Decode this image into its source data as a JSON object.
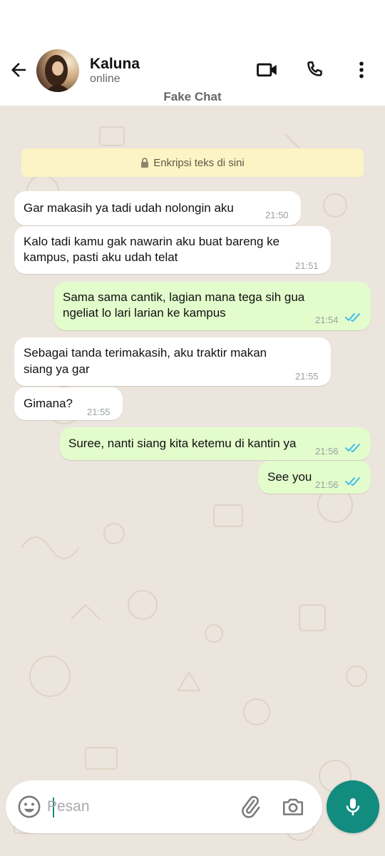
{
  "header": {
    "contact_name": "Kaluna",
    "contact_status": "online",
    "app_label": "Fake Chat",
    "icons": [
      "back-arrow-icon",
      "video-call-icon",
      "phone-icon",
      "more-vert-icon"
    ]
  },
  "encryption_notice": "Enkripsi teks di sini",
  "messages": [
    {
      "direction": "in",
      "text": "Gar makasih ya tadi udah nolongin aku",
      "time": "21:50"
    },
    {
      "direction": "in",
      "line1": "Kalo tadi kamu gak nawarin aku buat bareng ke",
      "line2": "kampus, pasti aku udah telat",
      "time": "21:51"
    },
    {
      "direction": "out",
      "line1": "Sama sama cantik, lagian mana tega sih gua",
      "line2": "ngeliat lo lari larian ke kampus",
      "time": "21:54",
      "status": "read"
    },
    {
      "direction": "in",
      "line1": "Sebagai tanda terimakasih, aku traktir makan",
      "line2": "siang ya gar",
      "time": "21:55"
    },
    {
      "direction": "in",
      "text": "Gimana?",
      "time": "21:55"
    },
    {
      "direction": "out",
      "text": "Suree, nanti siang kita ketemu di kantin ya",
      "time": "21:56",
      "status": "read"
    },
    {
      "direction": "out",
      "text": "See you",
      "time": "21:56",
      "status": "read"
    }
  ],
  "composer": {
    "placeholder": "Pesan",
    "value": "",
    "icons": [
      "emoji-icon",
      "attachment-icon",
      "camera-icon",
      "microphone-icon"
    ]
  },
  "colors": {
    "accent": "#128c7e",
    "chat_background": "#ece5dd",
    "outgoing_bubble": "#e2fccc",
    "incoming_bubble": "#ffffff",
    "encryption_banner": "#fcf4c4",
    "read_tick": "#34b7f1"
  }
}
